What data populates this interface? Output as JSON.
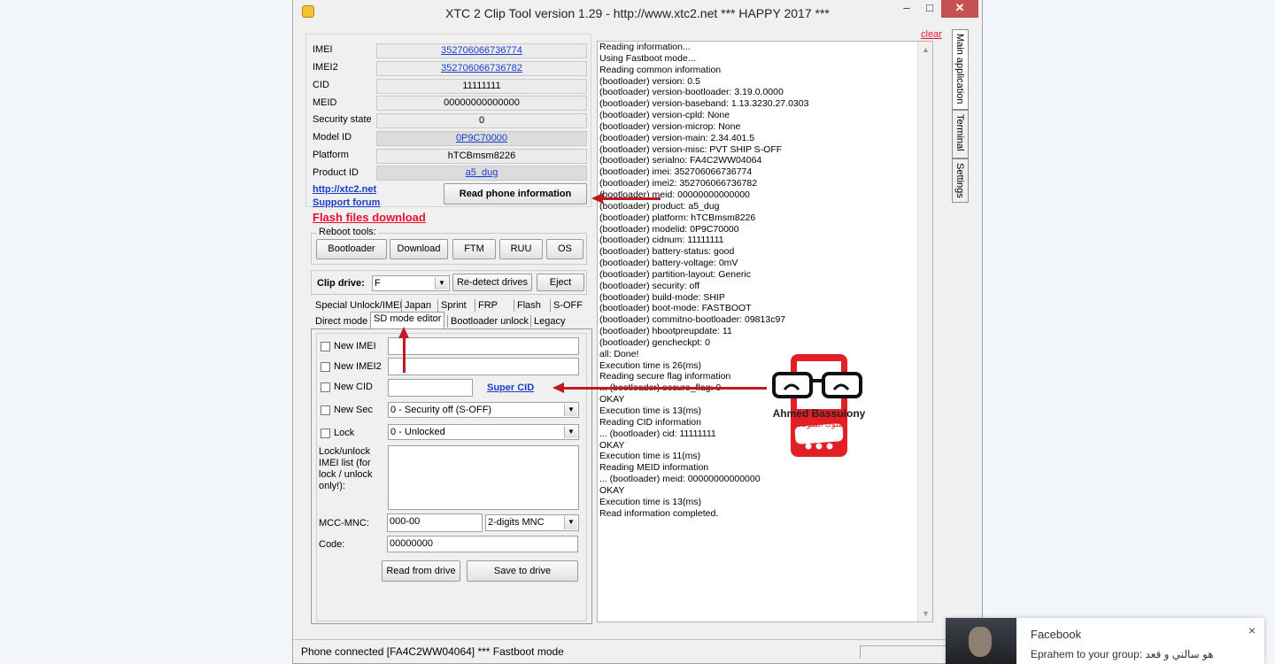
{
  "window": {
    "title": "XTC 2 Clip Tool version 1.29 - http://www.xtc2.net *** HAPPY 2017 ***",
    "min_glyph": "–",
    "max_glyph": "□",
    "close_glyph": "✕"
  },
  "info": {
    "imei_label": "IMEI",
    "imei_value": "352706066736774",
    "imei2_label": "IMEI2",
    "imei2_value": "352706066736782",
    "cid_label": "CID",
    "cid_value": "11111111",
    "meid_label": "MEID",
    "meid_value": "00000000000000",
    "security_label": "Security state",
    "security_value": "0",
    "model_label": "Model ID",
    "model_value": "0P9C70000",
    "platform_label": "Platform",
    "platform_value": "hTCBmsm8226",
    "product_label": "Product ID",
    "product_value": "a5_dug"
  },
  "links": {
    "site": "http://xtc2.net",
    "forum": "Support forum",
    "flash": "Flash files download"
  },
  "read_button": "Read phone information",
  "reboot": {
    "title": "Reboot tools:",
    "bootloader": "Bootloader",
    "download": "Download",
    "ftm": "FTM",
    "ruu": "RUU",
    "os": "OS"
  },
  "clip": {
    "label": "Clip drive:",
    "value": "F",
    "redetect": "Re-detect drives",
    "eject": "Eject"
  },
  "tabs": {
    "row1": [
      "Special Unlock/IMEI",
      "Japan",
      "Sprint",
      "FRP",
      "Flash",
      "S-OFF"
    ],
    "row2": [
      "Direct mode",
      "SD mode editor",
      "Bootloader unlock",
      "Legacy"
    ]
  },
  "sd": {
    "new_imei": "New IMEI",
    "new_imei2": "New IMEI2",
    "new_cid": "New CID",
    "super_cid": "Super CID",
    "new_sec": "New Sec",
    "sec_value": "0 -  Security off (S-OFF)",
    "lock": "Lock",
    "lock_value": "0 - Unlocked",
    "lock_list_label": "Lock/unlock IMEI list (for lock / unlock only!):",
    "mcc_label": "MCC-MNC:",
    "mcc_value": "000-00",
    "mnc_type": "2-digits MNC",
    "code_label": "Code:",
    "code_value": "00000000",
    "read_drive": "Read from drive",
    "save_drive": "Save to drive"
  },
  "log": {
    "clear": "clear",
    "lines": [
      "Reading information...",
      "Using Fastboot mode...",
      "Reading common information",
      "(bootloader) version: 0.5",
      "(bootloader) version-bootloader: 3.19.0.0000",
      "(bootloader) version-baseband: 1.13.3230.27.0303",
      "(bootloader) version-cpld: None",
      "(bootloader) version-microp: None",
      "(bootloader) version-main: 2.34.401.5",
      "(bootloader) version-misc: PVT SHIP S-OFF",
      "(bootloader) serialno: FA4C2WW04064",
      "(bootloader) imei: 352706066736774",
      "(bootloader) imei2: 352706066736782",
      "(bootloader) meid: 00000000000000",
      "(bootloader) product: a5_dug",
      "(bootloader) platform: hTCBmsm8226",
      "(bootloader) modelid: 0P9C70000",
      "(bootloader) cidnum: 11111111",
      "(bootloader) battery-status: good",
      "(bootloader) battery-voltage: 0mV",
      "(bootloader) partition-layout: Generic",
      "(bootloader) security: off",
      "(bootloader) build-mode: SHIP",
      "(bootloader) boot-mode: FASTBOOT",
      "(bootloader) commitno-bootloader: 09813c97",
      "(bootloader) hbootpreupdate: 11",
      "(bootloader) gencheckpt: 0",
      "all: Done!",
      "Execution time is 26(ms)",
      "Reading secure flag information",
      "... (bootloader) secure_flag: 0",
      "OKAY",
      "Execution time is 13(ms)",
      "Reading CID information",
      "... (bootloader) cid: 11111111",
      "OKAY",
      "Execution time is 11(ms)",
      "Reading MEID information",
      "... (bootloader) meid: 00000000000000",
      "OKAY",
      "Execution time is 13(ms)",
      "Read information completed."
    ]
  },
  "side_tabs": [
    "Main application",
    "Terminal",
    "Settings"
  ],
  "status": "Phone connected [FA4C2WW04064] *** Fastboot mode",
  "watermark": {
    "name": "Ahmed Bassuiony",
    "sub": "ملوك السوفت"
  },
  "notification": {
    "title": "Facebook",
    "message": "Eprahem to your group: هو سالني و قعد",
    "close": "×"
  },
  "colors": {
    "accent_red": "#c0191f",
    "link_blue": "#1a3ccc",
    "flash_red": "#e8102a"
  }
}
